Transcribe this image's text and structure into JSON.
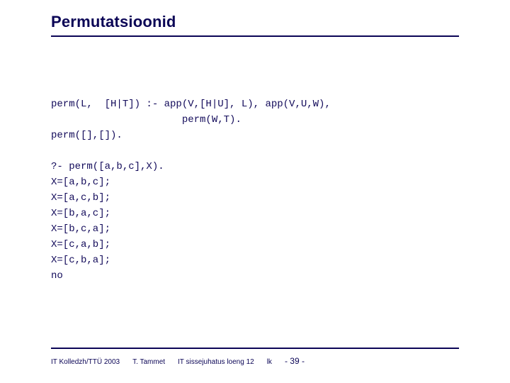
{
  "title": "Permutatsioonid",
  "code": "perm(L,  [H|T]) :- app(V,[H|U], L), app(V,U,W),\n                      perm(W,T).\nperm([],[]).\n\n?- perm([a,b,c],X).\nX=[a,b,c];\nX=[a,c,b];\nX=[b,a,c];\nX=[b,c,a];\nX=[c,a,b];\nX=[c,b,a];\nno",
  "footer": {
    "org": "IT Kolledzh/TTÜ 2003",
    "author": "T. Tammet",
    "course": "IT sissejuhatus loeng 12",
    "page_label": "lk",
    "page_value": "- 39 -"
  }
}
